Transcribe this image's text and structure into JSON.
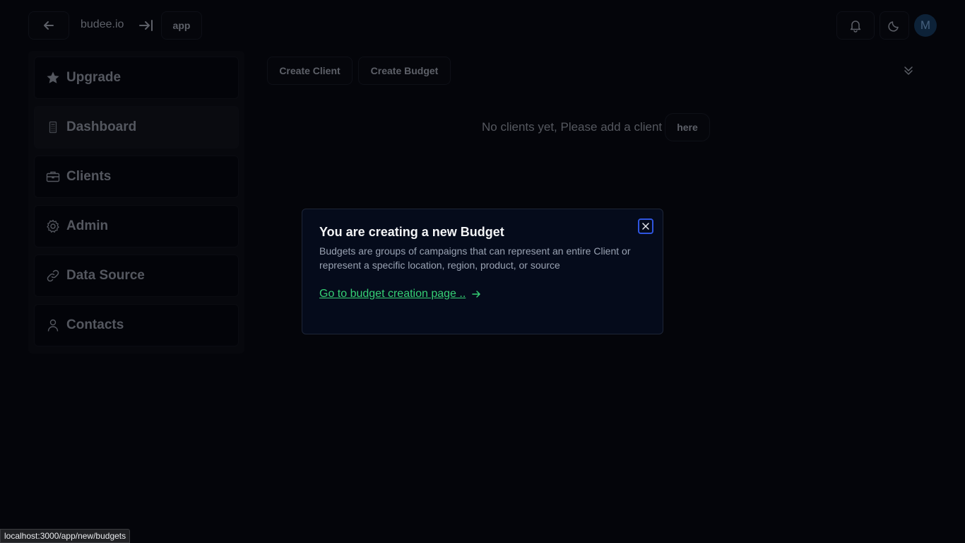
{
  "header": {
    "brand": "budee.io",
    "app_label": "app",
    "avatar_initial": "M"
  },
  "sidebar": {
    "items": [
      {
        "label": "Upgrade",
        "icon": "star-icon"
      },
      {
        "label": "Dashboard",
        "icon": "calculator-icon"
      },
      {
        "label": "Clients",
        "icon": "briefcase-icon"
      },
      {
        "label": "Admin",
        "icon": "gear-icon"
      },
      {
        "label": "Data Source",
        "icon": "link-icon"
      },
      {
        "label": "Contacts",
        "icon": "user-icon"
      }
    ]
  },
  "main": {
    "create_client_label": "Create Client",
    "create_budget_label": "Create Budget",
    "empty_message": "No clients yet, Please add a client",
    "here_label": "here"
  },
  "modal": {
    "title": "You are creating a new Budget",
    "description": "Budgets are groups of campaigns that can represent an entire Client or represent a specific location, region, product, or source",
    "link_label": "Go to budget creation page .."
  },
  "status_url": "localhost:3000/app/new/budgets",
  "colors": {
    "background": "#04050a",
    "modal_bg": "#050b1b",
    "link": "#35d075",
    "focus_ring": "#2f55e0"
  }
}
